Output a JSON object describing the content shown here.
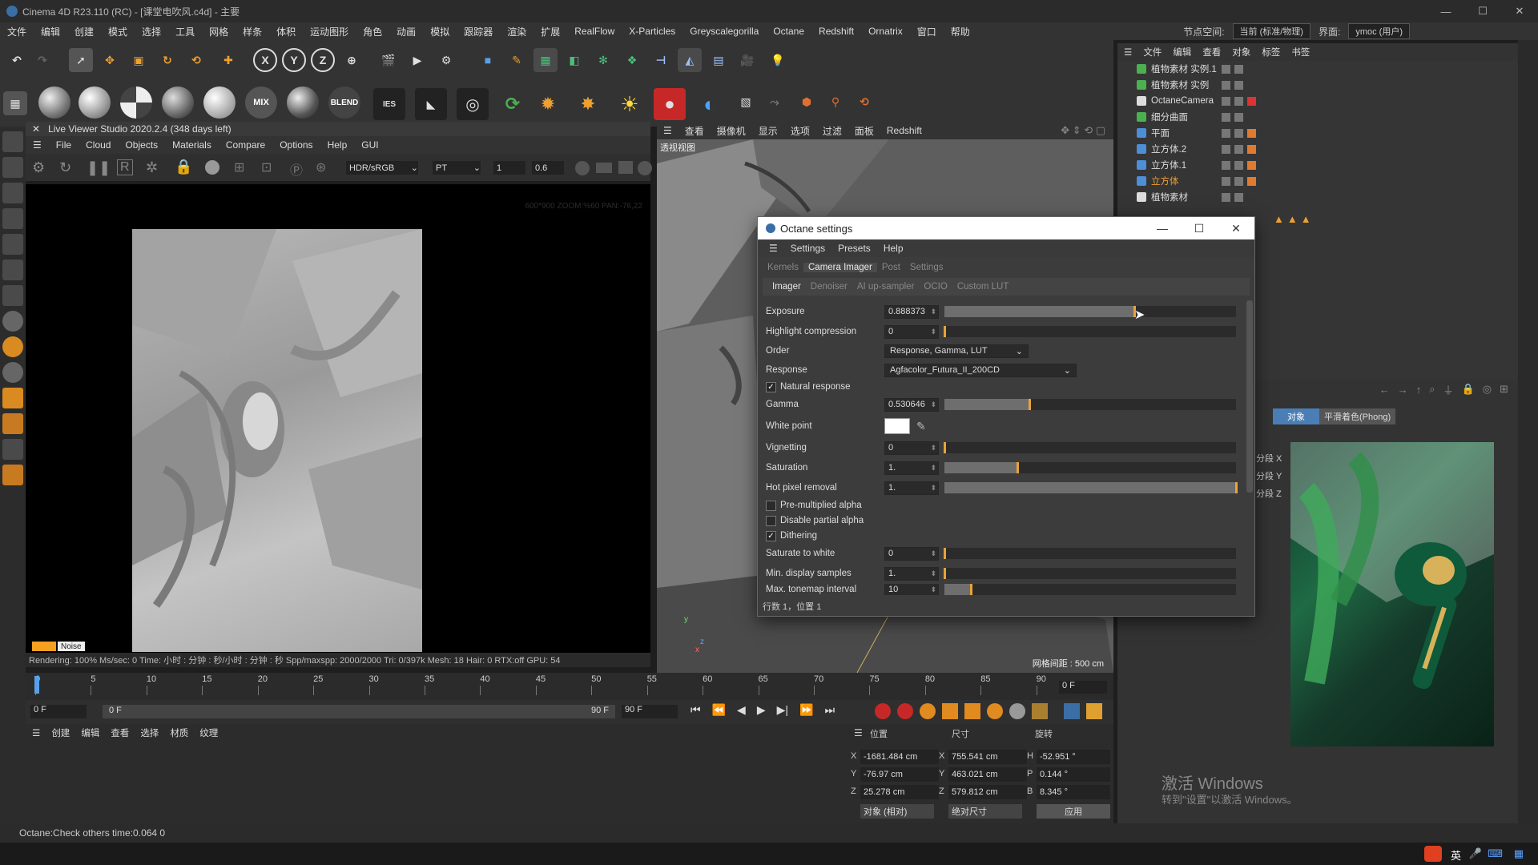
{
  "window": {
    "title": "Cinema 4D R23.110 (RC) - [课堂电吹风.c4d] - 主要"
  },
  "menubar": {
    "items": [
      "文件",
      "编辑",
      "创建",
      "模式",
      "选择",
      "工具",
      "网格",
      "样条",
      "体积",
      "运动图形",
      "角色",
      "动画",
      "模拟",
      "跟踪器",
      "渲染",
      "扩展",
      "RealFlow",
      "X-Particles",
      "Greyscalegorilla",
      "Octane",
      "Redshift",
      "Ornatrix",
      "窗口",
      "帮助"
    ],
    "node_space_label": "节点空间:",
    "node_space_value": "当前 (标准/物理)",
    "interface_label": "界面:",
    "interface_value": "ymoc (用户)"
  },
  "toolbar2": {
    "mix_label": "MIX",
    "blend_label": "BLEND",
    "ies_label": "IES"
  },
  "live_viewer": {
    "header": "Live Viewer Studio 2020.2.4 (348 days left)",
    "menu": [
      "File",
      "Cloud",
      "Objects",
      "Materials",
      "Compare",
      "Options",
      "Help",
      "GUI"
    ],
    "color_space": "HDR/sRGB",
    "kernel": "PT",
    "field1": "1",
    "field2": "0.6",
    "overlay_info": "600*900 ZOOM:%60  PAN:-76,22",
    "noise_label": "Noise",
    "status": "Rendering: 100%   Ms/sec: 0   Time: 小时 : 分钟 : 秒/小时 : 分钟 : 秒   Spp/maxspp: 2000/2000  Tri: 0/397k   Mesh: 18   Hair: 0   RTX:off   GPU:   54"
  },
  "viewport": {
    "menu": [
      "查看",
      "摄像机",
      "显示",
      "选项",
      "过滤",
      "面板",
      "Redshift"
    ],
    "label": "透视视图",
    "grid_info": "网格间距 : 500 cm",
    "axis_y": "y",
    "axis_z": "z",
    "axis_x": "x"
  },
  "octane_dialog": {
    "title": "Octane settings",
    "menu": [
      "Settings",
      "Presets",
      "Help"
    ],
    "tabs": [
      "Kernels",
      "Camera Imager",
      "Post",
      "Settings"
    ],
    "subtabs": [
      "Imager",
      "Denoiser",
      "AI up-sampler",
      "OCIO",
      "Custom LUT"
    ],
    "rows": {
      "exposure": {
        "label": "Exposure",
        "value": "0.888373",
        "fill": 0.65
      },
      "highlight": {
        "label": "Highlight compression",
        "value": "0",
        "fill": 0.0
      },
      "order": {
        "label": "Order",
        "value": "Response, Gamma, LUT"
      },
      "response": {
        "label": "Response",
        "value": "Agfacolor_Futura_II_200CD"
      },
      "natural": {
        "label": "Natural response",
        "checked": true
      },
      "gamma": {
        "label": "Gamma",
        "value": "0.530646",
        "fill": 0.29
      },
      "whitepoint": {
        "label": "White point"
      },
      "vignetting": {
        "label": "Vignetting",
        "value": "0",
        "fill": 0.0
      },
      "saturation": {
        "label": "Saturation",
        "value": "1.",
        "fill": 0.25
      },
      "hotpixel": {
        "label": "Hot pixel removal",
        "value": "1.",
        "fill": 1.0
      },
      "premult": {
        "label": "Pre-multiplied alpha",
        "checked": false
      },
      "partial": {
        "label": "Disable partial alpha",
        "checked": false
      },
      "dither": {
        "label": "Dithering",
        "checked": true
      },
      "satwhite": {
        "label": "Saturate to white",
        "value": "0",
        "fill": 0.0
      },
      "mindisp": {
        "label": "Min. display samples",
        "value": "1.",
        "fill": 0.0
      },
      "maxtone": {
        "label": "Max. tonemap interval",
        "value": "10",
        "fill": 0.09
      }
    },
    "footer": "行数 1，位置 1"
  },
  "object_manager": {
    "menu": [
      "文件",
      "编辑",
      "查看",
      "对象",
      "标签",
      "书签"
    ],
    "objects": [
      "植物素材 实例.1",
      "植物素材 实例",
      "OctaneCamera",
      "细分曲面",
      "平面",
      "立方体.2",
      "立方体.1",
      "立方体",
      "植物素材"
    ]
  },
  "attributes": {
    "tabs": [
      "对象",
      "平滑着色(Phong)"
    ],
    "fields": [
      "分段 X",
      "分段 Y",
      "分段 Z"
    ],
    "watermark_line1": "激活 Windows",
    "watermark_line2": "转到\"设置\"以激活 Windows。"
  },
  "timeline": {
    "ticks": [
      "0",
      "5",
      "10",
      "15",
      "20",
      "25",
      "30",
      "35",
      "40",
      "45",
      "50",
      "55",
      "60",
      "65",
      "70",
      "75",
      "80",
      "85",
      "90"
    ],
    "end_frame": "0 F",
    "start": "0 F",
    "range_start": "0 F",
    "range_end": "90 F",
    "range_end2": "90 F"
  },
  "material_manager": {
    "menu": [
      "创建",
      "编辑",
      "查看",
      "选择",
      "材质",
      "纹理"
    ]
  },
  "coordinates": {
    "headers": [
      "位置",
      "尺寸",
      "旋转"
    ],
    "pos": {
      "x": "-1681.484 cm",
      "y": "-76.97 cm",
      "z": "25.278 cm"
    },
    "size": {
      "x": "755.541 cm",
      "y": "463.021 cm",
      "z": "579.812 cm"
    },
    "rot": {
      "h": "-52.951 °",
      "p": "0.144 °",
      "b": "8.345 °"
    },
    "mode1": "对象 (相对)",
    "mode2": "绝对尺寸",
    "apply": "应用"
  },
  "status": {
    "text": "Octane:Check others time:0.064   0"
  },
  "taskbar": {
    "ime": "英"
  }
}
